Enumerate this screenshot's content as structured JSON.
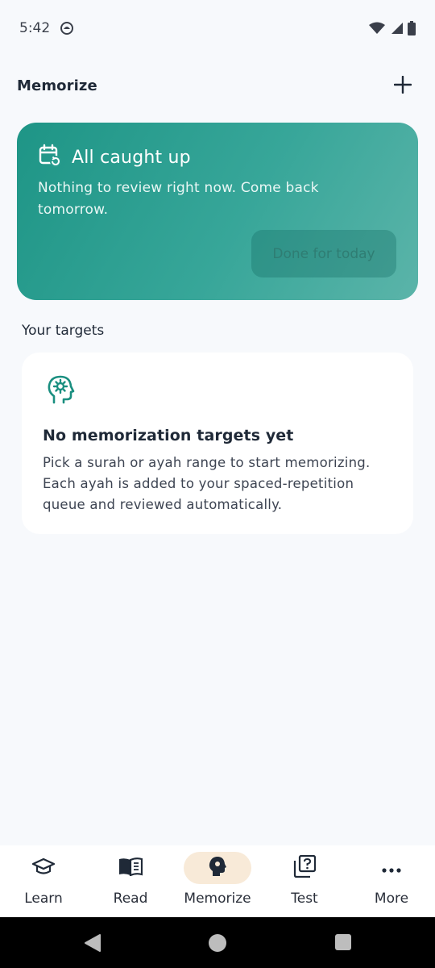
{
  "status_bar": {
    "time": "5:42",
    "icons": [
      "app-notification-icon",
      "wifi-icon",
      "signal-icon",
      "battery-icon"
    ]
  },
  "header": {
    "title": "Memorize",
    "add_icon": "plus-icon"
  },
  "review_card": {
    "icon": "calendar-refresh-icon",
    "title": "All caught up",
    "description": "Nothing to review right now. Come back tomorrow.",
    "button_label": "Done for today",
    "colors": {
      "gradient_start": "#1e9586",
      "gradient_end": "#5bb4a9"
    }
  },
  "targets": {
    "section_title": "Your targets",
    "empty_icon": "head-gear-icon",
    "empty_title": "No memorization targets yet",
    "empty_description": "Pick a surah or ayah range to start memorizing. Each ayah is added to your spaced-repetition queue and reviewed automatically."
  },
  "bottom_nav": {
    "items": [
      {
        "label": "Learn",
        "icon": "graduation-cap-icon",
        "active": false
      },
      {
        "label": "Read",
        "icon": "open-book-icon",
        "active": false
      },
      {
        "label": "Memorize",
        "icon": "head-gear-icon",
        "active": true
      },
      {
        "label": "Test",
        "icon": "quiz-cards-icon",
        "active": false
      },
      {
        "label": "More",
        "icon": "more-dots-icon",
        "active": false
      }
    ],
    "active_color": "#f8ead8"
  },
  "system_nav": {
    "buttons": [
      "back-icon",
      "home-icon",
      "recents-icon"
    ]
  }
}
